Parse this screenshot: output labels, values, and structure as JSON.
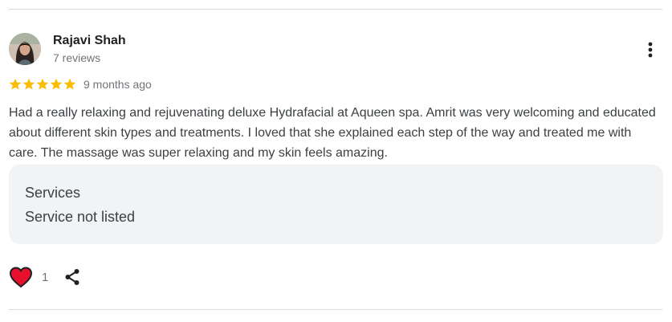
{
  "reviewer": {
    "name": "Rajavi Shah",
    "review_count": "7 reviews"
  },
  "rating": {
    "stars": 5,
    "max": 5,
    "time_ago": "9 months ago",
    "star_color": "#fbbc04"
  },
  "review": {
    "text": "Had a really relaxing and rejuvenating deluxe Hydrafacial at Aqueen spa. Amrit was very welcoming and educated about different skin types and treatments. I loved that she explained each step of the way and treated me with care. The massage was super relaxing and my skin feels amazing."
  },
  "details": {
    "label": "Services",
    "value": "Service not listed"
  },
  "actions": {
    "like_count": "1",
    "like_icon": "heart-icon",
    "like_color": "#e8112d",
    "share_icon": "share-icon",
    "more_icon": "more-vert-icon"
  }
}
